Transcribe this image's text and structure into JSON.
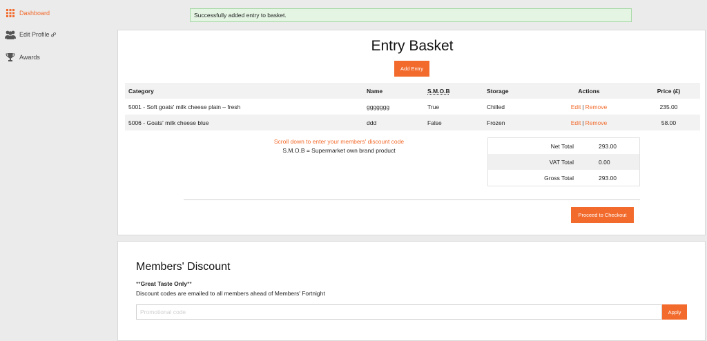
{
  "sidebar": {
    "items": [
      {
        "label": "Dashboard",
        "icon": "grid-icon",
        "active": true
      },
      {
        "label": "Edit Profile",
        "icon": "users-icon",
        "suffix_icon": "link-icon"
      },
      {
        "label": "Awards",
        "icon": "trophy-icon"
      }
    ]
  },
  "alert": {
    "message": "Successfully added entry to basket."
  },
  "basket": {
    "title": "Entry Basket",
    "add_entry_label": "Add Entry",
    "columns": {
      "category": "Category",
      "name": "Name",
      "smob": "S.M.O.B",
      "storage": "Storage",
      "actions": "Actions",
      "price": "Price (£)"
    },
    "rows": [
      {
        "category": "5001 - Soft goats' milk cheese plain – fresh",
        "name": "ggggggg",
        "smob": "True",
        "storage": "Chilled",
        "edit": "Edit",
        "separator": "|",
        "remove": "Remove",
        "price": "235.00"
      },
      {
        "category": "5006 - Goats' milk cheese blue",
        "name": "ddd",
        "smob": "False",
        "storage": "Frozen",
        "edit": "Edit",
        "separator": "|",
        "remove": "Remove",
        "price": "58.00"
      }
    ],
    "scroll_note": "Scroll down to enter your members' discount code",
    "smob_note": "S.M.O.B = Supermarket own brand product",
    "totals": [
      {
        "label": "Net Total",
        "value": "293.00"
      },
      {
        "label": "VAT Total",
        "value": "0.00"
      },
      {
        "label": "Gross Total",
        "value": "293.00"
      }
    ],
    "checkout_label": "Proceed to Checkout"
  },
  "discount": {
    "title": "Members' Discount",
    "tag_prefix": "**",
    "tag_bold": "Great Taste Only",
    "tag_suffix": "**",
    "info": "Discount codes are emailed to all members ahead of Members' Fortnight",
    "placeholder": "Promotional code",
    "value": "",
    "apply_label": "Apply"
  },
  "colors": {
    "accent": "#f26a2c",
    "alert_bg": "#e4f5e4",
    "alert_border": "#a6d9a6",
    "page_bg": "#ebebeb"
  }
}
